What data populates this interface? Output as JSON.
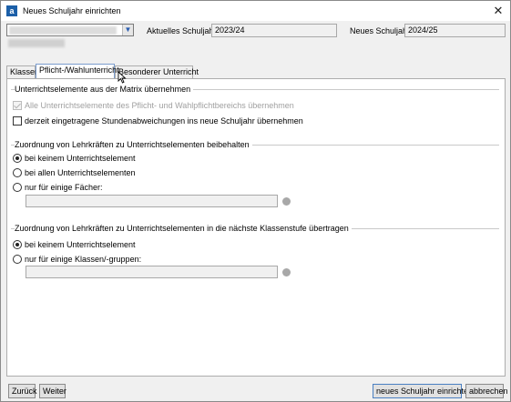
{
  "window": {
    "title": "Neues Schuljahr einrichten",
    "app_icon": "a"
  },
  "header": {
    "current_year_label": "Aktuelles Schuljahr",
    "current_year_value": "2023/24",
    "new_year_label": "Neues Schuljahr",
    "new_year_value": "2024/25"
  },
  "tabs": [
    {
      "label": "Klassen"
    },
    {
      "label": "Pflicht-/Wahlunterricht",
      "active": true
    },
    {
      "label": "Besonderer Unterricht"
    }
  ],
  "group1": {
    "title": "Unterrichtselemente aus der Matrix übernehmen",
    "chk_all": "Alle Unterrichtselemente des Pflicht- und Wahlpflichtbereichs übernehmen",
    "chk_deviations": "derzeit eingetragene Stundenabweichungen ins neue Schuljahr übernehmen"
  },
  "group2": {
    "title": "Zuordnung von Lehrkräften zu Unterrichtselementen beibehalten",
    "opt_none": "bei keinem Unterrichtselement",
    "opt_all": "bei allen Unterrichtselementen",
    "opt_some": "nur für einige Fächer:"
  },
  "group3": {
    "title": "Zuordnung von Lehrkräften zu Unterrichtselementen in die nächste Klassenstufe übertragen",
    "opt_none": "bei keinem Unterrichtselement",
    "opt_some": "nur für einige Klassen/-gruppen:"
  },
  "footer": {
    "back": "Zurück",
    "next": "Weiter",
    "create": "neues Schuljahr einrichten",
    "cancel": "abbrechen"
  },
  "colors": {
    "accent": "#1c5fa8",
    "tab_border_active": "#7a9ccd"
  }
}
